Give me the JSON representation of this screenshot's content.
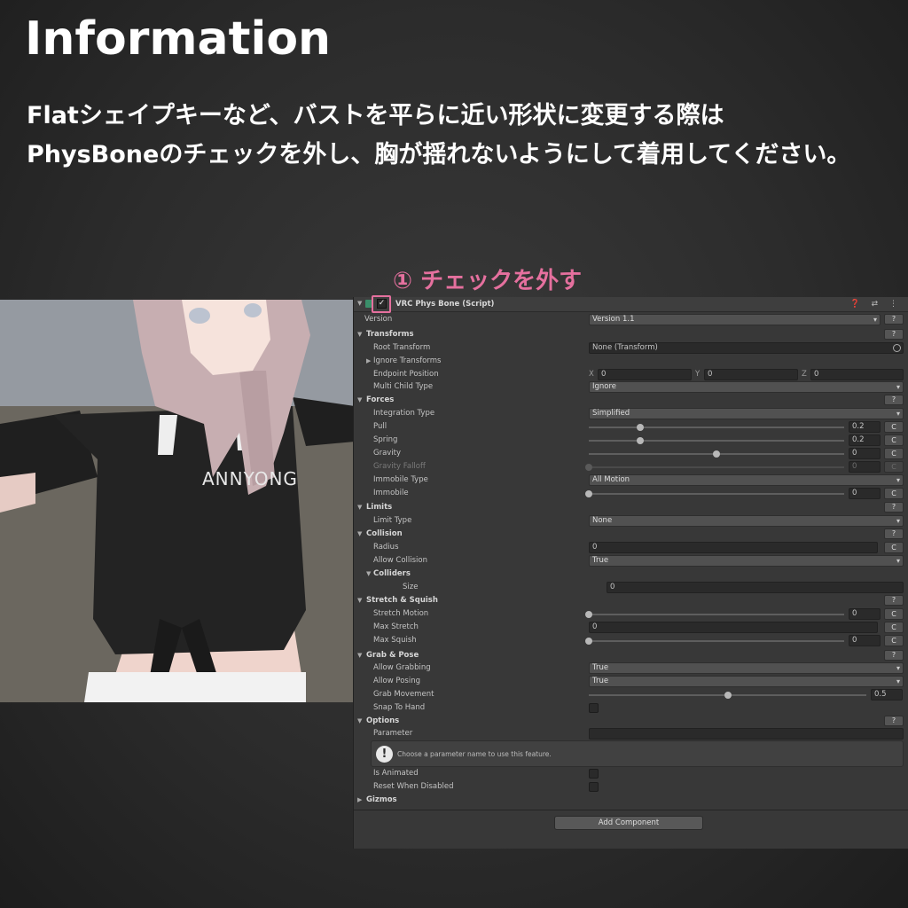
{
  "heading": "Information",
  "info": {
    "line1": "Flatシェイプキーなど、バストを平らに近い形状に変更する際は",
    "line2": "PhysBoneのチェックを外し、胸が揺れないようにして着用してください。"
  },
  "annotation": "① チェックを外す",
  "viewport": {
    "shirt_print": "ANNYONG"
  },
  "component": {
    "title": "VRC Phys Bone (Script)",
    "enabled_mark": "✓",
    "header_icons": "❓ ⇄ ⋮"
  },
  "fields": {
    "version_label": "Version",
    "version_value": "Version 1.1",
    "help": "?",
    "c": "C",
    "transforms": "Transforms",
    "root_transform_label": "Root Transform",
    "root_transform_value": "None (Transform)",
    "ignore_transforms": "Ignore Transforms",
    "endpoint_position": "Endpoint Position",
    "x_label": "X",
    "x_value": "0",
    "y_label": "Y",
    "y_value": "0",
    "z_label": "Z",
    "z_value": "0",
    "multi_child_type": "Multi Child Type",
    "multi_child_value": "Ignore",
    "forces": "Forces",
    "integration_type": "Integration Type",
    "integration_value": "Simplified",
    "pull": "Pull",
    "pull_value": "0.2",
    "spring": "Spring",
    "spring_value": "0.2",
    "gravity": "Gravity",
    "gravity_value": "0",
    "gravity_falloff": "Gravity Falloff",
    "gravity_falloff_value": "0",
    "immobile_type": "Immobile Type",
    "immobile_type_value": "All Motion",
    "immobile": "Immobile",
    "immobile_value": "0",
    "limits": "Limits",
    "limit_type": "Limit Type",
    "limit_type_value": "None",
    "collision": "Collision",
    "radius": "Radius",
    "radius_value": "0",
    "allow_collision": "Allow Collision",
    "allow_collision_value": "True",
    "colliders": "Colliders",
    "size": "Size",
    "size_value": "0",
    "stretch_squish": "Stretch & Squish",
    "stretch_motion": "Stretch Motion",
    "stretch_motion_value": "0",
    "max_stretch": "Max Stretch",
    "max_stretch_value": "0",
    "max_squish": "Max Squish",
    "max_squish_value": "0",
    "grab_pose": "Grab & Pose",
    "allow_grabbing": "Allow Grabbing",
    "allow_grabbing_value": "True",
    "allow_posing": "Allow Posing",
    "allow_posing_value": "True",
    "grab_movement": "Grab Movement",
    "grab_movement_value": "0.5",
    "snap_to_hand": "Snap To Hand",
    "options": "Options",
    "parameter": "Parameter",
    "parameter_help": "Choose a parameter name to use this feature.",
    "is_animated": "Is Animated",
    "reset_when_disabled": "Reset When Disabled",
    "gizmos": "Gizmos"
  },
  "slider_levels": {
    "pull": 0.2,
    "spring": 0.2,
    "gravity": 0.5,
    "gravity_falloff": 0,
    "immobile": 0,
    "stretch_motion": 0,
    "max_squish": 0,
    "grab_movement": 0.5
  },
  "add_component": "Add Component"
}
